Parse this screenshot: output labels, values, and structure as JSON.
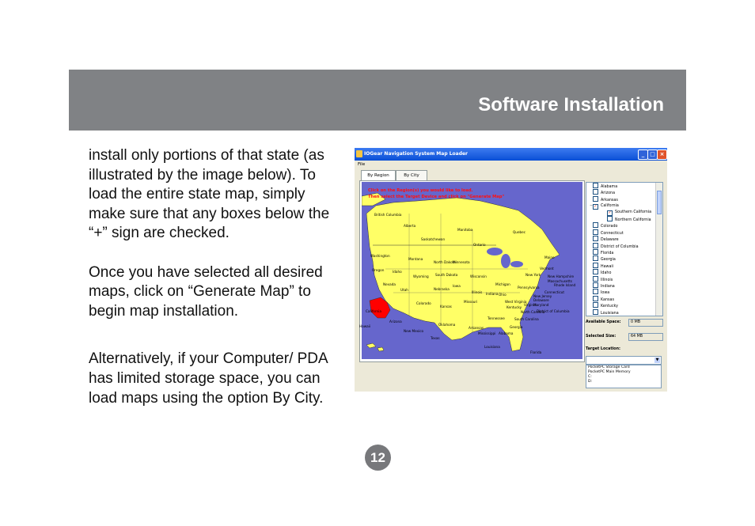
{
  "header": {
    "title": "Software Installation"
  },
  "body": {
    "paragraphs": [
      "install only portions of that state (as illustrated by the image below).  To load the entire state map, simply make sure that any boxes below the “+” sign are checked.",
      "Once you have selected all desired maps, click on “Generate Map” to begin map installation.",
      "Alternatively, if your Computer/ PDA has limited storage space, you can load maps using the option By City."
    ]
  },
  "page_number": "12",
  "screenshot": {
    "window_title": "IOGear Navigation System Map Loader",
    "menu": [
      "File"
    ],
    "tabs": [
      "By Region",
      "By City"
    ],
    "map_instructions": [
      "Click on the Region(s) you would like to load.",
      "Then select the Target Device and click on \"Generate Map\""
    ],
    "map_labels": [
      {
        "text": "British Columbia"
      },
      {
        "text": "Alberta"
      },
      {
        "text": "Saskatchewan"
      },
      {
        "text": "Manitoba"
      },
      {
        "text": "Quebec"
      },
      {
        "text": "Ontario"
      },
      {
        "text": "Washington"
      },
      {
        "text": "Montana"
      },
      {
        "text": "North Dakota"
      },
      {
        "text": "Minnesota"
      },
      {
        "text": "Oregon"
      },
      {
        "text": "Idaho"
      },
      {
        "text": "Wyoming"
      },
      {
        "text": "South Dakota"
      },
      {
        "text": "Nevada"
      },
      {
        "text": "Utah"
      },
      {
        "text": "Colorado"
      },
      {
        "text": "Nebraska"
      },
      {
        "text": "Iowa"
      },
      {
        "text": "California"
      },
      {
        "text": "Arizona"
      },
      {
        "text": "New Mexico"
      },
      {
        "text": "Kansas"
      },
      {
        "text": "Oklahoma"
      },
      {
        "text": "Texas"
      },
      {
        "text": "Missouri"
      },
      {
        "text": "Arkansas"
      },
      {
        "text": "Louisiana"
      },
      {
        "text": "Mississippi"
      },
      {
        "text": "Alabama"
      },
      {
        "text": "Georgia"
      },
      {
        "text": "Florida"
      },
      {
        "text": "Tennessee"
      },
      {
        "text": "Kentucky"
      },
      {
        "text": "Illinois"
      },
      {
        "text": "Indiana"
      },
      {
        "text": "Ohio"
      },
      {
        "text": "Michigan"
      },
      {
        "text": "Wisconsin"
      },
      {
        "text": "Virginia"
      },
      {
        "text": "North Carolina"
      },
      {
        "text": "South Carolina"
      },
      {
        "text": "New York"
      },
      {
        "text": "Pennsylvania"
      },
      {
        "text": "Maine"
      },
      {
        "text": "Vermont"
      },
      {
        "text": "New Hampshire"
      },
      {
        "text": "Massachusetts"
      },
      {
        "text": "Rhode Island"
      },
      {
        "text": "Connecticut"
      },
      {
        "text": "New Jersey"
      },
      {
        "text": "Delaware"
      },
      {
        "text": "Maryland"
      },
      {
        "text": "District of Columbia"
      },
      {
        "text": "West Virginia"
      },
      {
        "text": "Hawaii"
      }
    ],
    "states": [
      {
        "label": "Alabama",
        "checked": false,
        "indent": 0
      },
      {
        "label": "Arizona",
        "checked": false,
        "indent": 0
      },
      {
        "label": "Arkansas",
        "checked": false,
        "indent": 0
      },
      {
        "label": "California",
        "checked": true,
        "indent": 0,
        "expander": "−"
      },
      {
        "label": "Southern California",
        "checked": true,
        "indent": 1
      },
      {
        "label": "Northern California",
        "checked": false,
        "indent": 1
      },
      {
        "label": "Colorado",
        "checked": false,
        "indent": 0
      },
      {
        "label": "Connecticut",
        "checked": false,
        "indent": 0
      },
      {
        "label": "Delaware",
        "checked": false,
        "indent": 0
      },
      {
        "label": "District of Columbia",
        "checked": false,
        "indent": 0
      },
      {
        "label": "Florida",
        "checked": false,
        "indent": 0
      },
      {
        "label": "Georgia",
        "checked": false,
        "indent": 0
      },
      {
        "label": "Hawaii",
        "checked": false,
        "indent": 0
      },
      {
        "label": "Idaho",
        "checked": false,
        "indent": 0
      },
      {
        "label": "Illinois",
        "checked": false,
        "indent": 0
      },
      {
        "label": "Indiana",
        "checked": false,
        "indent": 0
      },
      {
        "label": "Iowa",
        "checked": false,
        "indent": 0
      },
      {
        "label": "Kansas",
        "checked": false,
        "indent": 0
      },
      {
        "label": "Kentucky",
        "checked": false,
        "indent": 0
      },
      {
        "label": "Louisiana",
        "checked": false,
        "indent": 0
      }
    ],
    "available_space_label": "Available Space:",
    "available_space_value": "0 MB",
    "selected_size_label": "Selected Size:",
    "selected_size_value": "64 MB",
    "target_location_label": "Target Location:",
    "target_locations": [
      "PocketPC Storage Card",
      "PocketPC Main Memory",
      "C:",
      "D:"
    ],
    "colors": {
      "land": "#ffff66",
      "water": "#6666cc",
      "selected": "#ff0000",
      "titlebar": "#0a4fd6"
    }
  }
}
